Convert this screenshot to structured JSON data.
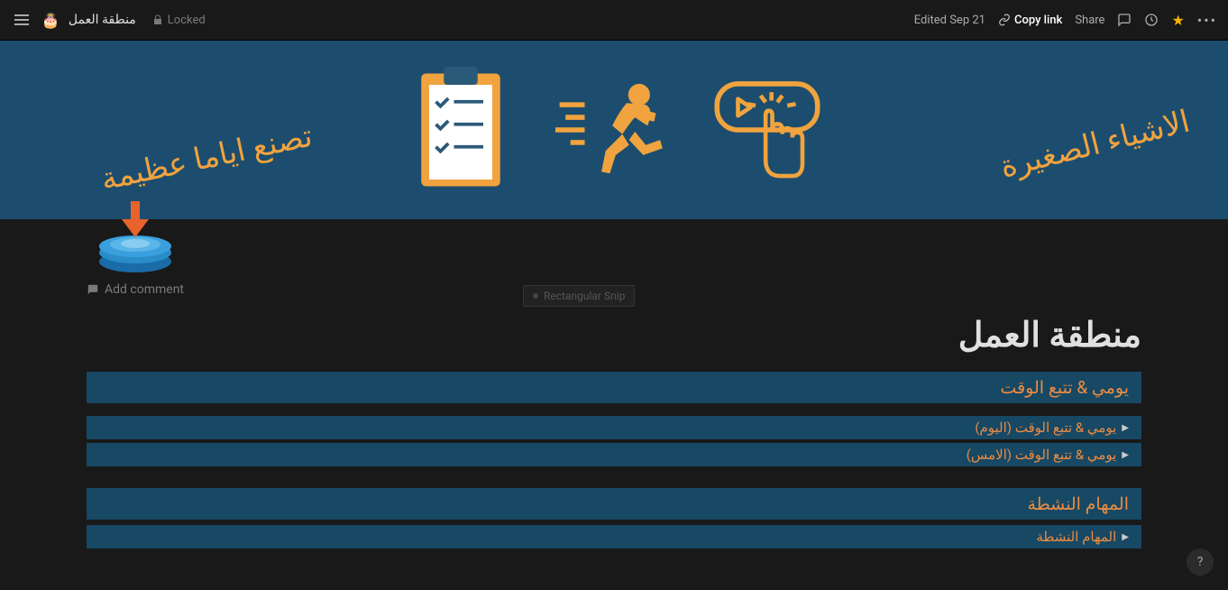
{
  "topbar": {
    "page_name": "منطقة العمل",
    "locked_label": "Locked",
    "edited_label": "Edited Sep 21",
    "copy_link_label": "Copy link",
    "share_label": "Share"
  },
  "cover": {
    "text_left": "تصنع اياما عظيمة",
    "text_right": "الاشياء الصغيرة"
  },
  "add_comment_label": "Add comment",
  "page_title": "منطقة العمل",
  "sections": [
    {
      "header": "يومي & تتبع الوقت",
      "rows": [
        "يومي & تتبع الوقت (اليوم)",
        "يومي & تتبع الوقت (الامس)"
      ]
    },
    {
      "header": "المهام النشطة",
      "rows": [
        "المهام النشطة"
      ]
    }
  ],
  "snip_label": "Rectangular Snip",
  "help_label": "?"
}
